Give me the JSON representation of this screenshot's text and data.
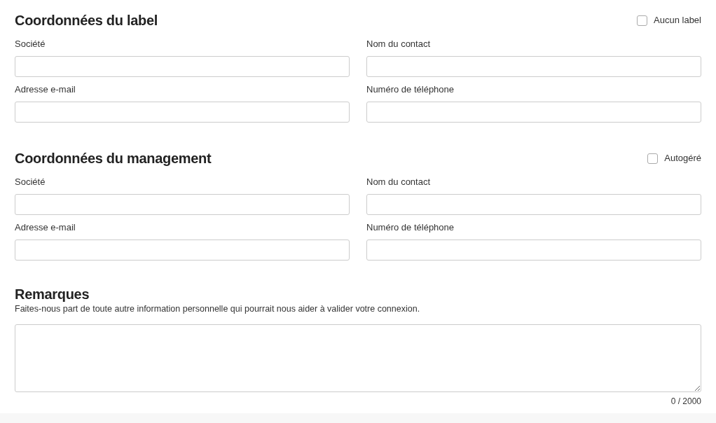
{
  "sections": [
    {
      "title": "Coordonnées du label",
      "checkbox": {
        "label": "Aucun label",
        "checked": false
      },
      "fields": [
        {
          "label": "Société"
        },
        {
          "label": "Nom du contact"
        },
        {
          "label": "Adresse e-mail"
        },
        {
          "label": "Numéro de téléphone"
        }
      ]
    },
    {
      "title": "Coordonnées du management",
      "checkbox": {
        "label": "Autogéré",
        "checked": false
      },
      "fields": [
        {
          "label": "Société"
        },
        {
          "label": "Nom du contact"
        },
        {
          "label": "Adresse e-mail"
        },
        {
          "label": "Numéro de téléphone"
        }
      ]
    }
  ],
  "remarks": {
    "title": "Remarques",
    "description": "Faites-nous part de toute autre information personnelle qui pourrait nous aider à valider votre connexion.",
    "counter": "0 / 2000"
  }
}
